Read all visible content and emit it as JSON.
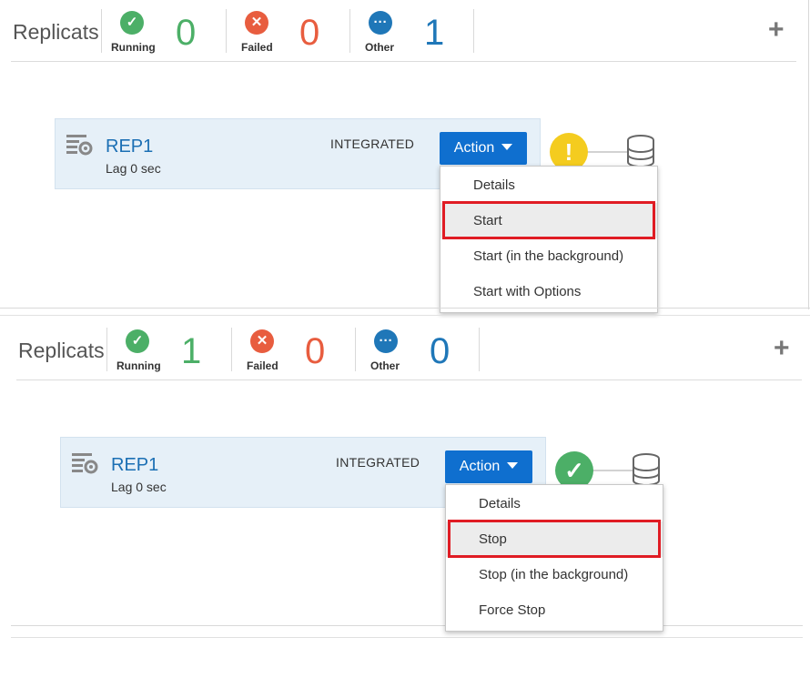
{
  "top": {
    "header": {
      "title": "Replicats",
      "stats": [
        {
          "label": "Running",
          "count": "0",
          "icon": "check-icon",
          "color": "#4caf67"
        },
        {
          "label": "Failed",
          "count": "0",
          "icon": "x-icon",
          "color": "#e85d3f"
        },
        {
          "label": "Other",
          "count": "1",
          "icon": "ellipsis-icon",
          "color": "#1f77b8"
        }
      ],
      "add_icon": "plus-icon"
    },
    "card": {
      "name": "REP1",
      "lag": "Lag 0 sec",
      "mode": "INTEGRATED",
      "action_label": "Action",
      "status": "warning",
      "status_icon": "exclamation-icon",
      "status_color": "#f4cc1f"
    },
    "menu": {
      "items": [
        "Details",
        "Start",
        "Start (in the background)",
        "Start with Options"
      ],
      "highlighted": "Start"
    }
  },
  "bottom": {
    "header": {
      "title": "Replicats",
      "stats": [
        {
          "label": "Running",
          "count": "1",
          "icon": "check-icon",
          "color": "#4caf67"
        },
        {
          "label": "Failed",
          "count": "0",
          "icon": "x-icon",
          "color": "#e85d3f"
        },
        {
          "label": "Other",
          "count": "0",
          "icon": "ellipsis-icon",
          "color": "#1f77b8"
        }
      ],
      "add_icon": "plus-icon"
    },
    "card": {
      "name": "REP1",
      "lag": "Lag 0 sec",
      "mode": "INTEGRATED",
      "action_label": "Action",
      "status": "running",
      "status_icon": "check-icon",
      "status_color": "#4caf67"
    },
    "menu": {
      "items": [
        "Details",
        "Stop",
        "Stop (in the background)",
        "Force Stop"
      ],
      "highlighted": "Stop"
    }
  },
  "colors": {
    "accent": "#0f6fcf",
    "link": "#1b6fb4",
    "highlight_border": "#e01c24",
    "card_bg": "#e6f0f8"
  }
}
